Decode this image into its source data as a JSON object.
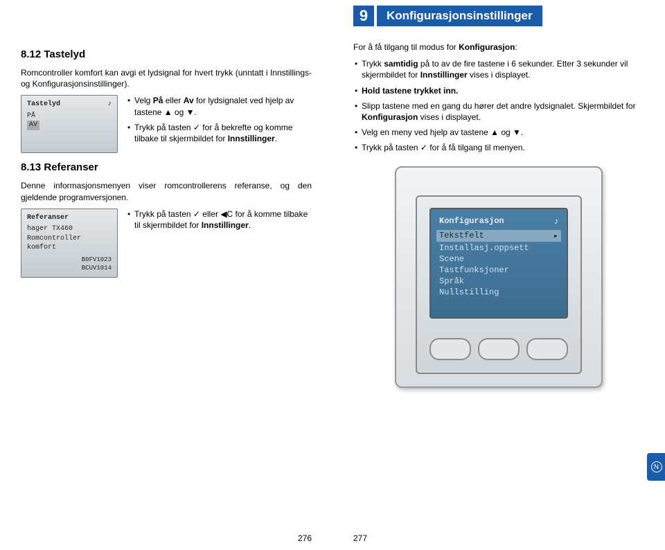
{
  "left": {
    "s812_title": "8.12 Tastelyd",
    "s812_intro": "Romcontroller komfort kan avgi et lydsignal for hvert trykk (unntatt i Innstillings- og Konfigurasjonsinstillinger).",
    "lcd812": {
      "title": "Tastelyd",
      "icon": "♪",
      "line1": "PÅ",
      "line2_hl": "AV"
    },
    "s812_b1_pre": "Velg ",
    "s812_b1_b1": "På",
    "s812_b1_mid": " eller ",
    "s812_b1_b2": "Av",
    "s812_b1_post": " for lydsignalet ved hjelp av tastene ▲ og ▼.",
    "s812_b2_pre": "Trykk på tasten ✓ for å bekrefte og komme tilbake til skjermbildet for ",
    "s812_b2_b": "Innstillinger",
    "s812_b2_post": ".",
    "s813_title": "8.13 Referanser",
    "s813_intro": "Denne informasjonsmenyen viser romcontrollerens referanse, og den gjeldende programversjonen.",
    "lcd813": {
      "title": "Referanser",
      "l1": "hager TX460",
      "l2": "Romcontroller",
      "l3": "komfort",
      "f1": "B0FV1023",
      "f2": "BCUV1014"
    },
    "s813_b1_pre": "Trykk på tasten ✓ eller ◀C for å komme tilbake til skjermbildet for ",
    "s813_b1_b": "Innstillinger",
    "s813_b1_post": ".",
    "page_num": "276"
  },
  "right": {
    "chapter_num": "9",
    "chapter_title": "Konfigurasjonsinstillinger",
    "intro_pre": "For å få tilgang til modus for ",
    "intro_b": "Konfigurasjon",
    "intro_post": ":",
    "b1_pre": "Trykk ",
    "b1_b1": "samtidig",
    "b1_mid": " på to av de fire tastene i 6 sekunder. Etter 3 sekunder vil skjermbildet for ",
    "b1_b2": "Innstillinger",
    "b1_post": " vises i displayet.",
    "b2_b": "Hold tastene trykket inn.",
    "b3_pre": "Slipp tastene med en gang du hører det andre lydsignalet. Skjermbildet for ",
    "b3_b": "Konfigurasjon",
    "b3_post": " vises i displayet.",
    "b4": "Velg en meny ved hjelp av tastene ▲ og ▼.",
    "b5": "Trykk på tasten ✓ for å få tilgang til menyen.",
    "device_screen": {
      "header": "Konfigurasjon",
      "header_icon": "♪",
      "rows": [
        {
          "label": "Tekstfelt",
          "selected": true
        },
        {
          "label": "Installasj.oppsett",
          "selected": false
        },
        {
          "label": "Scene",
          "selected": false
        },
        {
          "label": "Tastfunksjoner",
          "selected": false
        },
        {
          "label": "Språk",
          "selected": false
        },
        {
          "label": "Nullstilling",
          "selected": false
        }
      ]
    },
    "side_tab": "N",
    "page_num": "277"
  }
}
